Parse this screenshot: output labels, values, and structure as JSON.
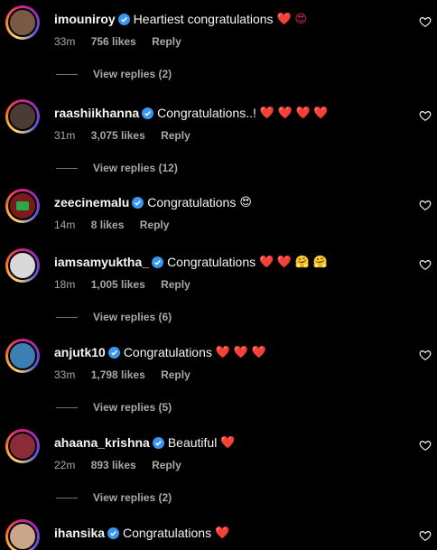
{
  "comments": [
    {
      "username": "imouniroy",
      "text": "Heartiest congratulations",
      "emoji": "❤️ 😍",
      "time": "33m",
      "likes": "756 likes",
      "reply": "Reply",
      "view_replies": "View replies (2)"
    },
    {
      "username": "raashiikhanna",
      "text": "Congratulations..!",
      "emoji": "❤️ ❤️ ❤️ ❤️",
      "time": "31m",
      "likes": "3,075 likes",
      "reply": "Reply",
      "view_replies": "View replies (12)"
    },
    {
      "username": "zeecinemalu",
      "text": "Congratulations",
      "emoji": "😍",
      "time": "14m",
      "likes": "8 likes",
      "reply": "Reply",
      "view_replies": ""
    },
    {
      "username": "iamsamyuktha_",
      "text": "Congratulations",
      "emoji": "❤️ ❤️ 🤗 🤗",
      "time": "18m",
      "likes": "1,005 likes",
      "reply": "Reply",
      "view_replies": "View replies (6)"
    },
    {
      "username": "anjutk10",
      "text": "Congratulations",
      "emoji": "❤️ ❤️ ❤️",
      "time": "33m",
      "likes": "1,798 likes",
      "reply": "Reply",
      "view_replies": "View replies (5)"
    },
    {
      "username": "ahaana_krishna",
      "text": "Beautiful",
      "emoji": "❤️",
      "time": "22m",
      "likes": "893 likes",
      "reply": "Reply",
      "view_replies": "View replies (2)"
    },
    {
      "username": "ihansika",
      "text": "Congratulations",
      "emoji": "❤️",
      "time": "",
      "likes": "",
      "reply": "",
      "view_replies": ""
    }
  ],
  "colors": {
    "background": "#000000",
    "verified": "#3897f0",
    "muted": "#a8a8a8"
  },
  "icons": {
    "verified": "verified-badge-icon",
    "like": "heart-outline-icon"
  }
}
